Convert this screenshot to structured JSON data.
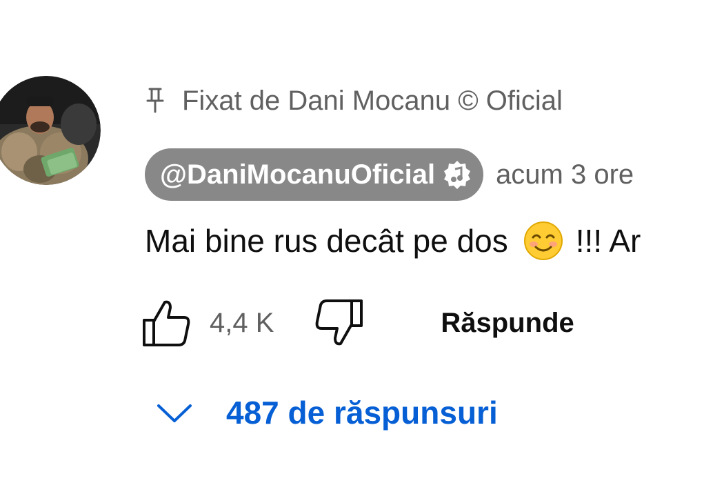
{
  "colors": {
    "text_primary": "#0f0f0f",
    "text_secondary": "#606060",
    "author_chip_bg": "#888888",
    "link_blue": "#065fd4"
  },
  "comment": {
    "pinned_label": "Fixat de Dani Mocanu © Oficial",
    "pin_icon": "pin-icon",
    "author_handle": "@DaniMocanuOficial",
    "author_badge_icon": "music-note-verified-icon",
    "time": "acum 3 ore",
    "text_before_emoji": "Mai bine rus decât pe dos",
    "emoji": "smiling-face-icon",
    "text_after_emoji": "!!! Ar",
    "like_icon": "thumbs-up-icon",
    "like_count": "4,4 K",
    "dislike_icon": "thumbs-down-icon",
    "reply_label": "Răspunde",
    "replies_icon": "chevron-down-icon",
    "replies_label": "487 de răspunsuri"
  }
}
